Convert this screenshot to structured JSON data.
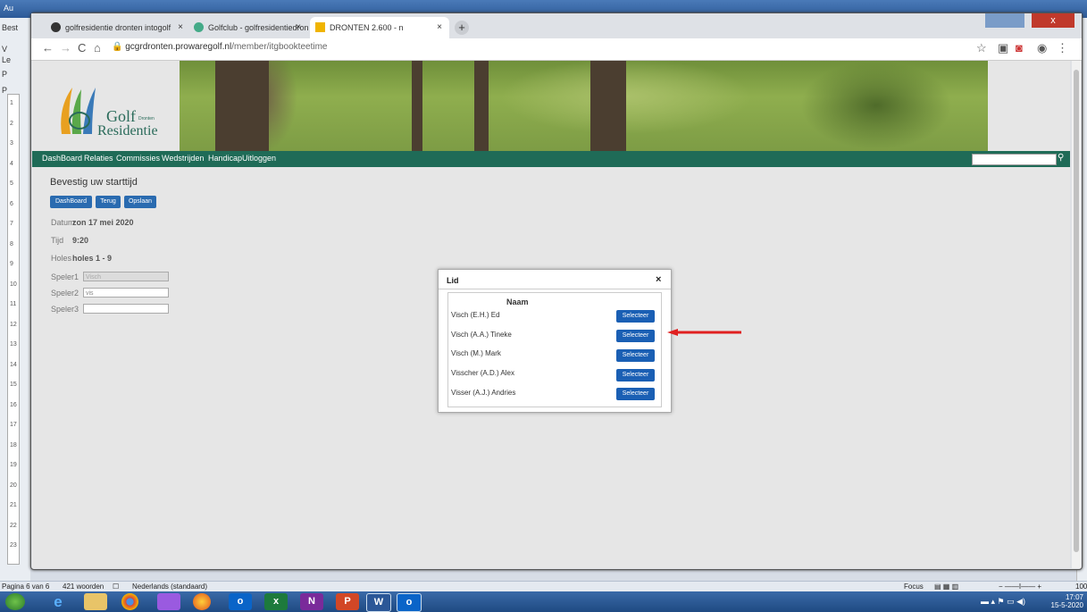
{
  "word": {
    "title_left": "Au",
    "side_labels": [
      "Best",
      "V",
      "Le",
      "P",
      "P"
    ],
    "status": {
      "page": "Pagina 6 van 6",
      "words": "421 woorden",
      "language": "Nederlands (standaard)",
      "focus": "Focus",
      "zoom": "100"
    }
  },
  "ruler_numbers": [
    "1",
    "2",
    "3",
    "4",
    "5",
    "6",
    "7",
    "8",
    "9",
    "10",
    "11",
    "12",
    "13",
    "14",
    "15",
    "16",
    "17",
    "18",
    "19",
    "20",
    "21",
    "22",
    "23"
  ],
  "taskbar": {
    "apps": [
      "e",
      "",
      "",
      "",
      "",
      "o",
      "x",
      "N",
      "P",
      "W",
      "o"
    ],
    "time": "17:07",
    "date": "15-5-2020"
  },
  "browser": {
    "tabs": [
      {
        "label": "golfresidentie dronten intogolf",
        "close": "×"
      },
      {
        "label": "Golfclub - golfresidentiedronten",
        "close": "×"
      },
      {
        "label": "DRONTEN 2.600 - n",
        "close": "×"
      }
    ],
    "new_tab": "+",
    "url_host": "gcgrdronten.prowaregolf.nl",
    "url_path": "/member/itgbookteetime",
    "win_close": "x"
  },
  "site": {
    "logo_text": "Golf",
    "logo_sub": "Dronten",
    "logo_text2": "Residentie",
    "nav": [
      "DashBoard",
      "Relaties",
      "Commissies",
      "Wedstrijden",
      "Handicap",
      "Uitloggen"
    ]
  },
  "booking": {
    "title": "Bevestig uw starttijd",
    "buttons": [
      "DashBoard",
      "Terug",
      "Opslaan"
    ],
    "fields": [
      {
        "label": "Datum",
        "value": "zon 17 mei 2020"
      },
      {
        "label": "Tijd",
        "value": "9:20"
      },
      {
        "label": "Holes",
        "value": "holes 1 - 9"
      }
    ],
    "players": [
      {
        "label": "Speler1",
        "value": "Visch"
      },
      {
        "label": "Speler2",
        "value": "vis"
      },
      {
        "label": "Speler3",
        "value": ""
      }
    ]
  },
  "modal": {
    "title": "Lid",
    "close": "×",
    "column": "Naam",
    "select_label": "Selecteer",
    "members": [
      "Visch (E.H.) Ed",
      "Visch (A.A.) Tineke",
      "Visch (M.) Mark",
      "Visscher (A.D.) Alex",
      "Visser (A.J.) Andries"
    ]
  },
  "colors": {
    "nav_bg": "#1f6b57",
    "button": "#2a6bb0",
    "arrow": "#e02020"
  }
}
